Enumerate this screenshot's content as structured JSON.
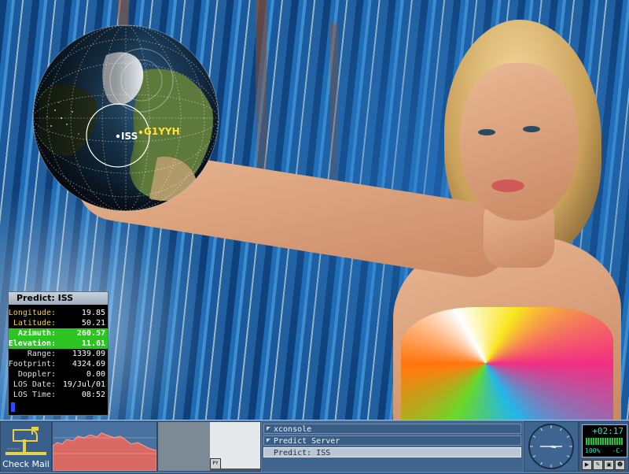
{
  "globe": {
    "sat_name": "ISS",
    "station_name": "G1YYH"
  },
  "predict": {
    "title": "Predict: ISS",
    "rows": [
      {
        "label": "Longitude:",
        "value": "19.85",
        "highlight": false,
        "label_color": "#ffd21a"
      },
      {
        "label": "Latitude:",
        "value": "50.21",
        "highlight": false,
        "label_color": "#ffd21a"
      },
      {
        "label": "Azimuth:",
        "value": "260.57",
        "highlight": true,
        "label_color": "#ffffff"
      },
      {
        "label": "Elevation:",
        "value": "11.61",
        "highlight": true,
        "label_color": "#ffffff"
      },
      {
        "label": "Range:",
        "value": "1339.09",
        "highlight": false,
        "label_color": "#e0e0e0"
      },
      {
        "label": "Footprint:",
        "value": "4324.69",
        "highlight": false,
        "label_color": "#e0e0e0"
      },
      {
        "label": "Doppler:",
        "value": "0.00",
        "highlight": false,
        "label_color": "#e0e0e0"
      },
      {
        "label": "LOS Date:",
        "value": "19/Jul/01",
        "highlight": false,
        "label_color": "#e0e0e0"
      },
      {
        "label": "LOS Time:",
        "value": "08:52",
        "highlight": false,
        "label_color": "#e0e0e0"
      }
    ]
  },
  "dock": {
    "mail_label": "Check Mail",
    "pager_mini_label": "PY",
    "tasks": [
      {
        "label": "xconsole",
        "active": false
      },
      {
        "label": "Predict Server",
        "active": false
      },
      {
        "label": "Predict: ISS",
        "active": true
      }
    ],
    "monitor": {
      "time": "+02:17",
      "percent": "100%",
      "plug": "-C-"
    }
  },
  "colors": {
    "sat_label": "#ffffff",
    "station_label": "#ffe23a",
    "accent_green": "#2cc421",
    "taskbar": "#5b7ca1"
  }
}
